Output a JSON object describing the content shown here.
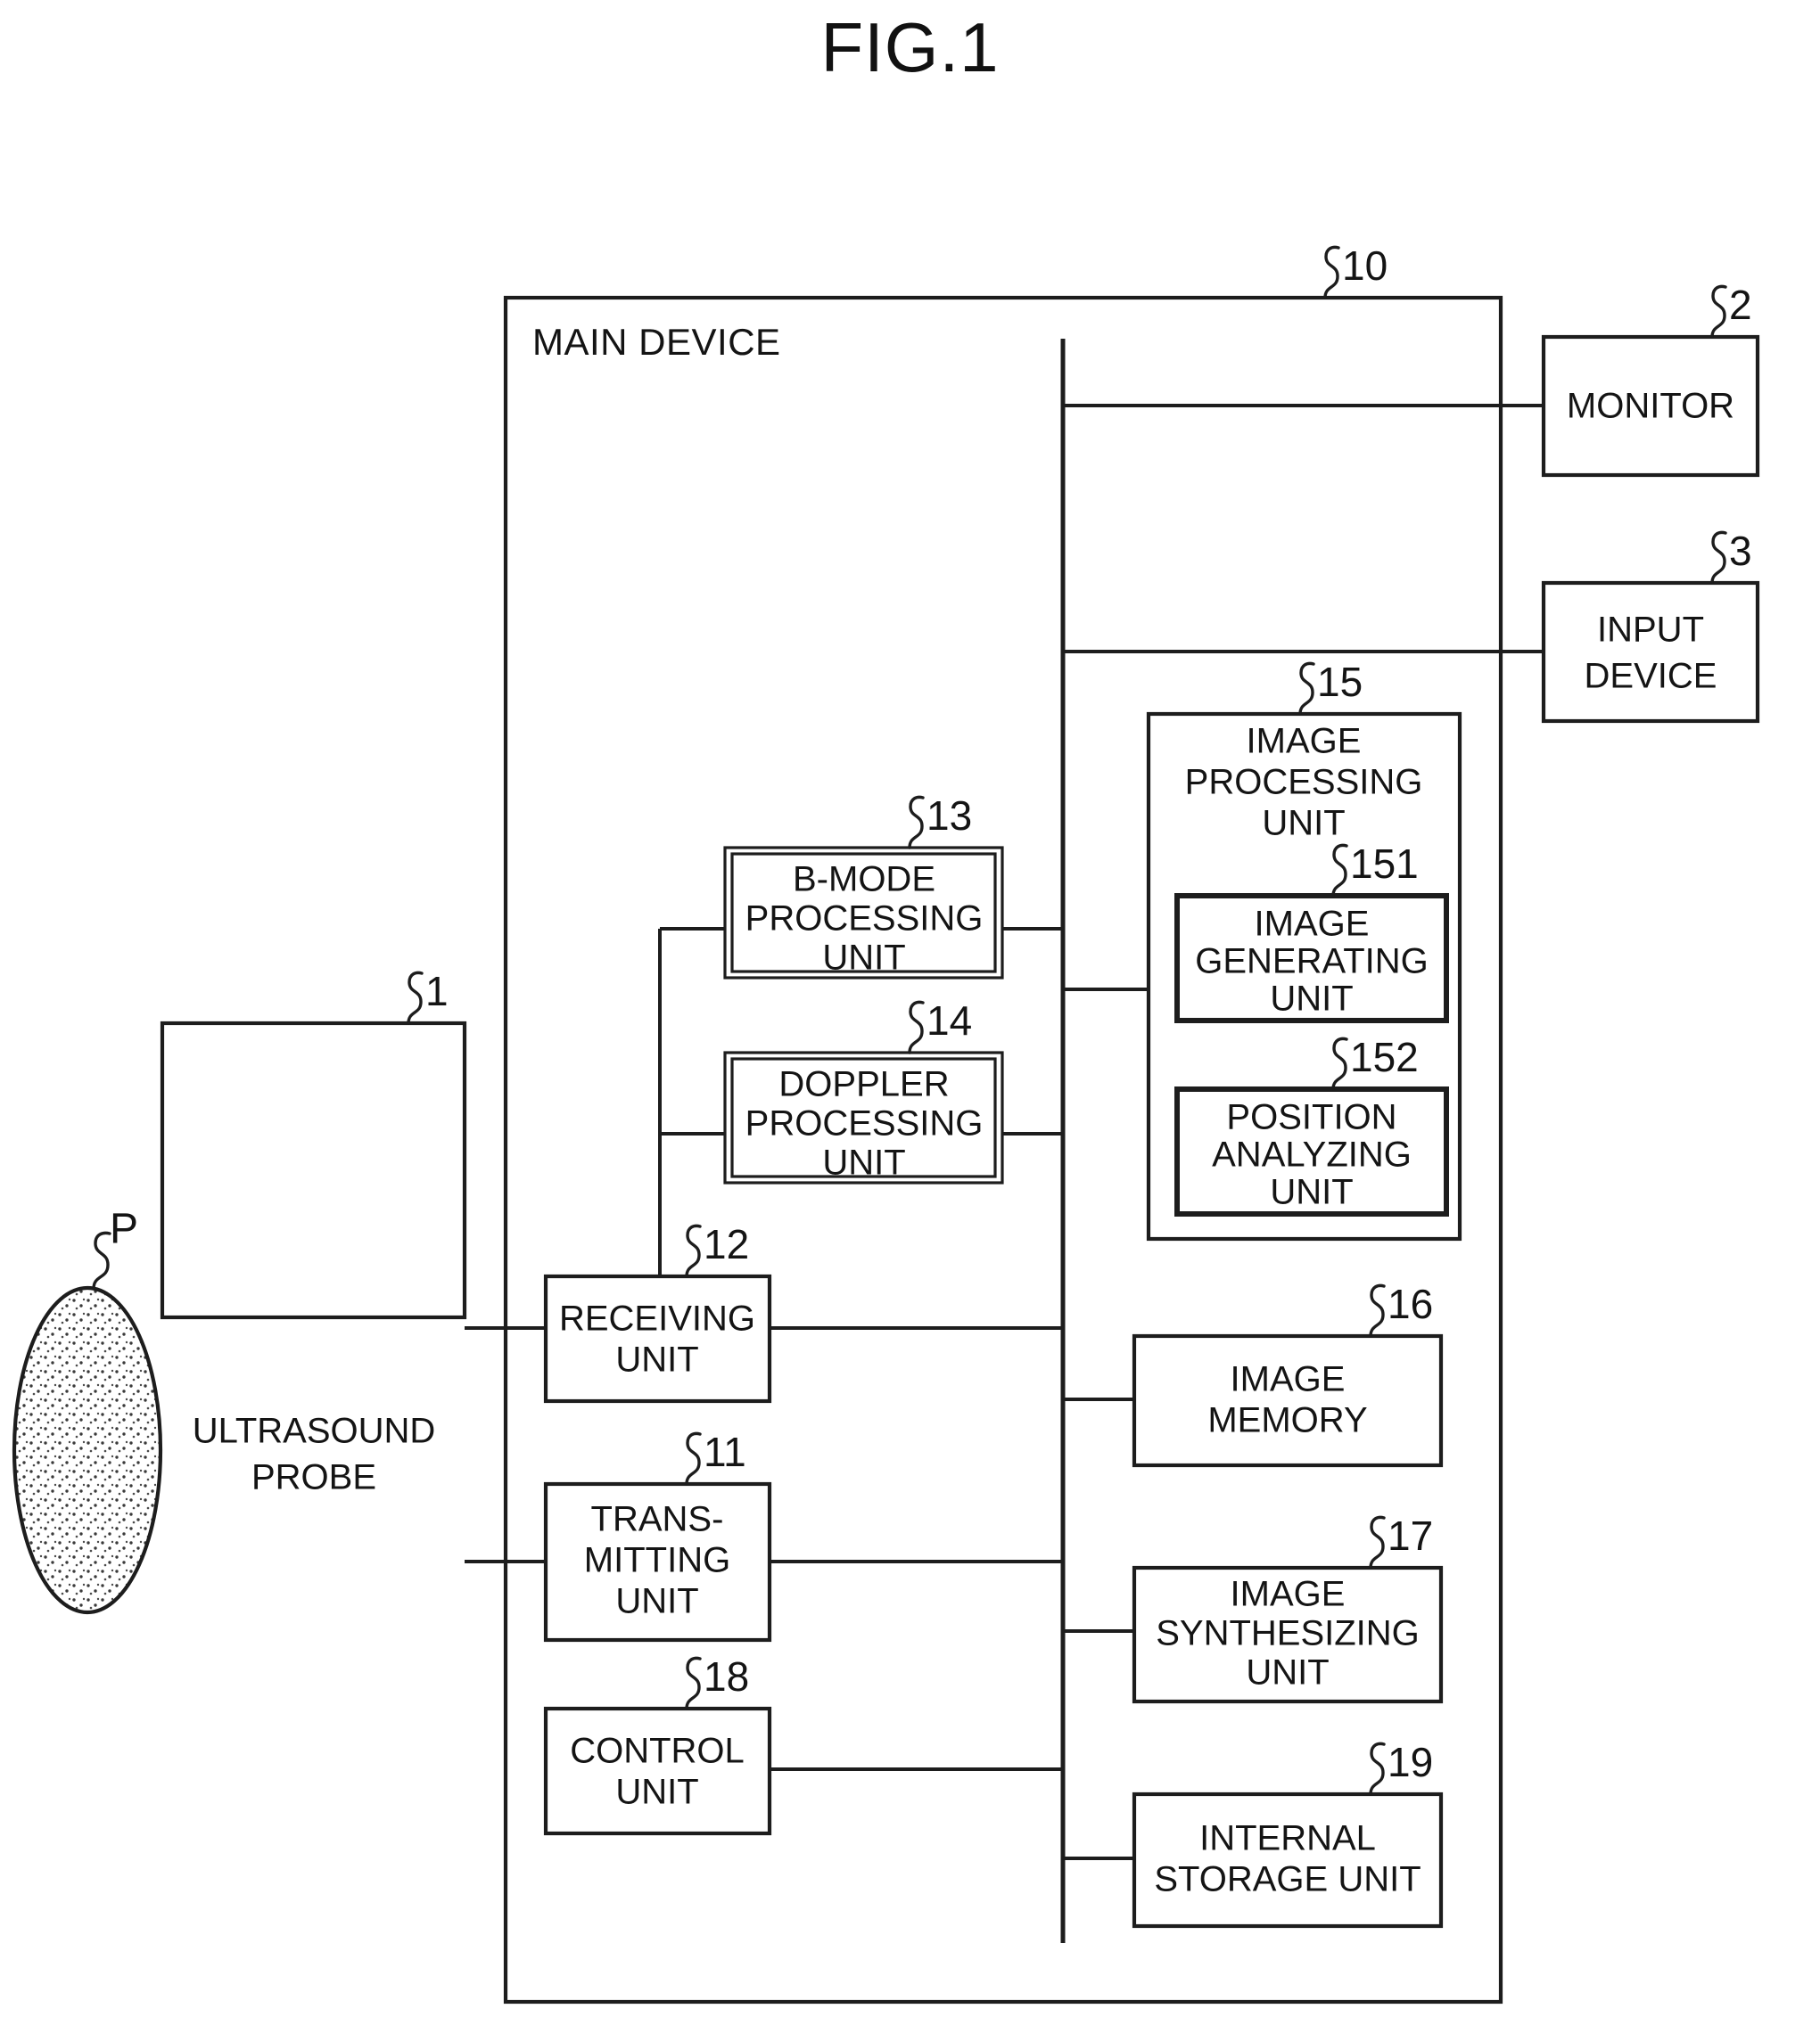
{
  "figure": {
    "title": "FIG.1",
    "type": "block-diagram",
    "subject": "ultrasound diagnostic apparatus"
  },
  "outer": {
    "label": "MAIN DEVICE",
    "ref": "10"
  },
  "subject_marker": {
    "label": "P",
    "shape": "stippled-ellipse"
  },
  "blocks": {
    "probe": {
      "ref": "1",
      "lines": [
        "ULTRASOUND",
        "PROBE"
      ]
    },
    "monitor": {
      "ref": "2",
      "lines": [
        "MONITOR"
      ]
    },
    "input_device": {
      "ref": "3",
      "lines": [
        "INPUT",
        "DEVICE"
      ]
    },
    "transmitting": {
      "ref": "11",
      "lines": [
        "TRANS-",
        "MITTING",
        "UNIT"
      ]
    },
    "receiving": {
      "ref": "12",
      "lines": [
        "RECEIVING",
        "UNIT"
      ]
    },
    "bmode": {
      "ref": "13",
      "lines": [
        "B-MODE",
        "PROCESSING",
        "UNIT"
      ]
    },
    "doppler": {
      "ref": "14",
      "lines": [
        "DOPPLER",
        "PROCESSING",
        "UNIT"
      ]
    },
    "image_proc": {
      "ref": "15",
      "lines": [
        "IMAGE",
        "PROCESSING",
        "UNIT"
      ]
    },
    "image_gen": {
      "ref": "151",
      "lines": [
        "IMAGE",
        "GENERATING",
        "UNIT"
      ]
    },
    "position_an": {
      "ref": "152",
      "lines": [
        "POSITION",
        "ANALYZING",
        "UNIT"
      ]
    },
    "image_memory": {
      "ref": "16",
      "lines": [
        "IMAGE",
        "MEMORY"
      ]
    },
    "image_synth": {
      "ref": "17",
      "lines": [
        "IMAGE",
        "SYNTHESIZING",
        "UNIT"
      ]
    },
    "control": {
      "ref": "18",
      "lines": [
        "CONTROL",
        "UNIT"
      ]
    },
    "internal_st": {
      "ref": "19",
      "lines": [
        "INTERNAL",
        "STORAGE UNIT"
      ]
    }
  },
  "colors": {
    "ink": "#1d1d1d",
    "paper": "#ffffff"
  }
}
